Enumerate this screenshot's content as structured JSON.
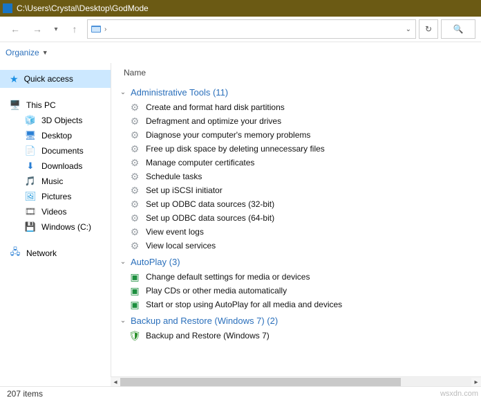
{
  "title": "C:\\Users\\Crystal\\Desktop\\GodMode",
  "toolbar": {
    "organize": "Organize"
  },
  "sidebar": {
    "quick_access": "Quick access",
    "this_pc": "This PC",
    "items": [
      {
        "label": "3D Objects"
      },
      {
        "label": "Desktop"
      },
      {
        "label": "Documents"
      },
      {
        "label": "Downloads"
      },
      {
        "label": "Music"
      },
      {
        "label": "Pictures"
      },
      {
        "label": "Videos"
      },
      {
        "label": "Windows (C:)"
      }
    ],
    "network": "Network"
  },
  "columns": {
    "name": "Name"
  },
  "groups": [
    {
      "title": "Administrative Tools (11)",
      "kind": "gear",
      "items": [
        "Create and format hard disk partitions",
        "Defragment and optimize your drives",
        "Diagnose your computer's memory problems",
        "Free up disk space by deleting unnecessary files",
        "Manage computer certificates",
        "Schedule tasks",
        "Set up iSCSI initiator",
        "Set up ODBC data sources (32-bit)",
        "Set up ODBC data sources (64-bit)",
        "View event logs",
        "View local services"
      ]
    },
    {
      "title": "AutoPlay (3)",
      "kind": "play",
      "items": [
        "Change default settings for media or devices",
        "Play CDs or other media automatically",
        "Start or stop using AutoPlay for all media and devices"
      ]
    },
    {
      "title": "Backup and Restore (Windows 7) (2)",
      "kind": "restore",
      "items": [
        "Backup and Restore (Windows 7)"
      ]
    }
  ],
  "status": {
    "count": "207 items"
  },
  "watermark": "wsxdn.com"
}
